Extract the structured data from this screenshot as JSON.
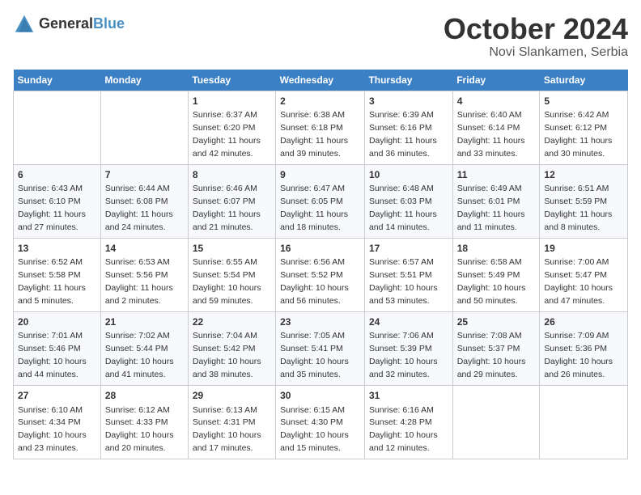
{
  "header": {
    "logo_general": "General",
    "logo_blue": "Blue",
    "month": "October 2024",
    "location": "Novi Slankamen, Serbia"
  },
  "days_of_week": [
    "Sunday",
    "Monday",
    "Tuesday",
    "Wednesday",
    "Thursday",
    "Friday",
    "Saturday"
  ],
  "weeks": [
    [
      {
        "day": "",
        "info": ""
      },
      {
        "day": "",
        "info": ""
      },
      {
        "day": "1",
        "info": "Sunrise: 6:37 AM\nSunset: 6:20 PM\nDaylight: 11 hours and 42 minutes."
      },
      {
        "day": "2",
        "info": "Sunrise: 6:38 AM\nSunset: 6:18 PM\nDaylight: 11 hours and 39 minutes."
      },
      {
        "day": "3",
        "info": "Sunrise: 6:39 AM\nSunset: 6:16 PM\nDaylight: 11 hours and 36 minutes."
      },
      {
        "day": "4",
        "info": "Sunrise: 6:40 AM\nSunset: 6:14 PM\nDaylight: 11 hours and 33 minutes."
      },
      {
        "day": "5",
        "info": "Sunrise: 6:42 AM\nSunset: 6:12 PM\nDaylight: 11 hours and 30 minutes."
      }
    ],
    [
      {
        "day": "6",
        "info": "Sunrise: 6:43 AM\nSunset: 6:10 PM\nDaylight: 11 hours and 27 minutes."
      },
      {
        "day": "7",
        "info": "Sunrise: 6:44 AM\nSunset: 6:08 PM\nDaylight: 11 hours and 24 minutes."
      },
      {
        "day": "8",
        "info": "Sunrise: 6:46 AM\nSunset: 6:07 PM\nDaylight: 11 hours and 21 minutes."
      },
      {
        "day": "9",
        "info": "Sunrise: 6:47 AM\nSunset: 6:05 PM\nDaylight: 11 hours and 18 minutes."
      },
      {
        "day": "10",
        "info": "Sunrise: 6:48 AM\nSunset: 6:03 PM\nDaylight: 11 hours and 14 minutes."
      },
      {
        "day": "11",
        "info": "Sunrise: 6:49 AM\nSunset: 6:01 PM\nDaylight: 11 hours and 11 minutes."
      },
      {
        "day": "12",
        "info": "Sunrise: 6:51 AM\nSunset: 5:59 PM\nDaylight: 11 hours and 8 minutes."
      }
    ],
    [
      {
        "day": "13",
        "info": "Sunrise: 6:52 AM\nSunset: 5:58 PM\nDaylight: 11 hours and 5 minutes."
      },
      {
        "day": "14",
        "info": "Sunrise: 6:53 AM\nSunset: 5:56 PM\nDaylight: 11 hours and 2 minutes."
      },
      {
        "day": "15",
        "info": "Sunrise: 6:55 AM\nSunset: 5:54 PM\nDaylight: 10 hours and 59 minutes."
      },
      {
        "day": "16",
        "info": "Sunrise: 6:56 AM\nSunset: 5:52 PM\nDaylight: 10 hours and 56 minutes."
      },
      {
        "day": "17",
        "info": "Sunrise: 6:57 AM\nSunset: 5:51 PM\nDaylight: 10 hours and 53 minutes."
      },
      {
        "day": "18",
        "info": "Sunrise: 6:58 AM\nSunset: 5:49 PM\nDaylight: 10 hours and 50 minutes."
      },
      {
        "day": "19",
        "info": "Sunrise: 7:00 AM\nSunset: 5:47 PM\nDaylight: 10 hours and 47 minutes."
      }
    ],
    [
      {
        "day": "20",
        "info": "Sunrise: 7:01 AM\nSunset: 5:46 PM\nDaylight: 10 hours and 44 minutes."
      },
      {
        "day": "21",
        "info": "Sunrise: 7:02 AM\nSunset: 5:44 PM\nDaylight: 10 hours and 41 minutes."
      },
      {
        "day": "22",
        "info": "Sunrise: 7:04 AM\nSunset: 5:42 PM\nDaylight: 10 hours and 38 minutes."
      },
      {
        "day": "23",
        "info": "Sunrise: 7:05 AM\nSunset: 5:41 PM\nDaylight: 10 hours and 35 minutes."
      },
      {
        "day": "24",
        "info": "Sunrise: 7:06 AM\nSunset: 5:39 PM\nDaylight: 10 hours and 32 minutes."
      },
      {
        "day": "25",
        "info": "Sunrise: 7:08 AM\nSunset: 5:37 PM\nDaylight: 10 hours and 29 minutes."
      },
      {
        "day": "26",
        "info": "Sunrise: 7:09 AM\nSunset: 5:36 PM\nDaylight: 10 hours and 26 minutes."
      }
    ],
    [
      {
        "day": "27",
        "info": "Sunrise: 6:10 AM\nSunset: 4:34 PM\nDaylight: 10 hours and 23 minutes."
      },
      {
        "day": "28",
        "info": "Sunrise: 6:12 AM\nSunset: 4:33 PM\nDaylight: 10 hours and 20 minutes."
      },
      {
        "day": "29",
        "info": "Sunrise: 6:13 AM\nSunset: 4:31 PM\nDaylight: 10 hours and 17 minutes."
      },
      {
        "day": "30",
        "info": "Sunrise: 6:15 AM\nSunset: 4:30 PM\nDaylight: 10 hours and 15 minutes."
      },
      {
        "day": "31",
        "info": "Sunrise: 6:16 AM\nSunset: 4:28 PM\nDaylight: 10 hours and 12 minutes."
      },
      {
        "day": "",
        "info": ""
      },
      {
        "day": "",
        "info": ""
      }
    ]
  ]
}
